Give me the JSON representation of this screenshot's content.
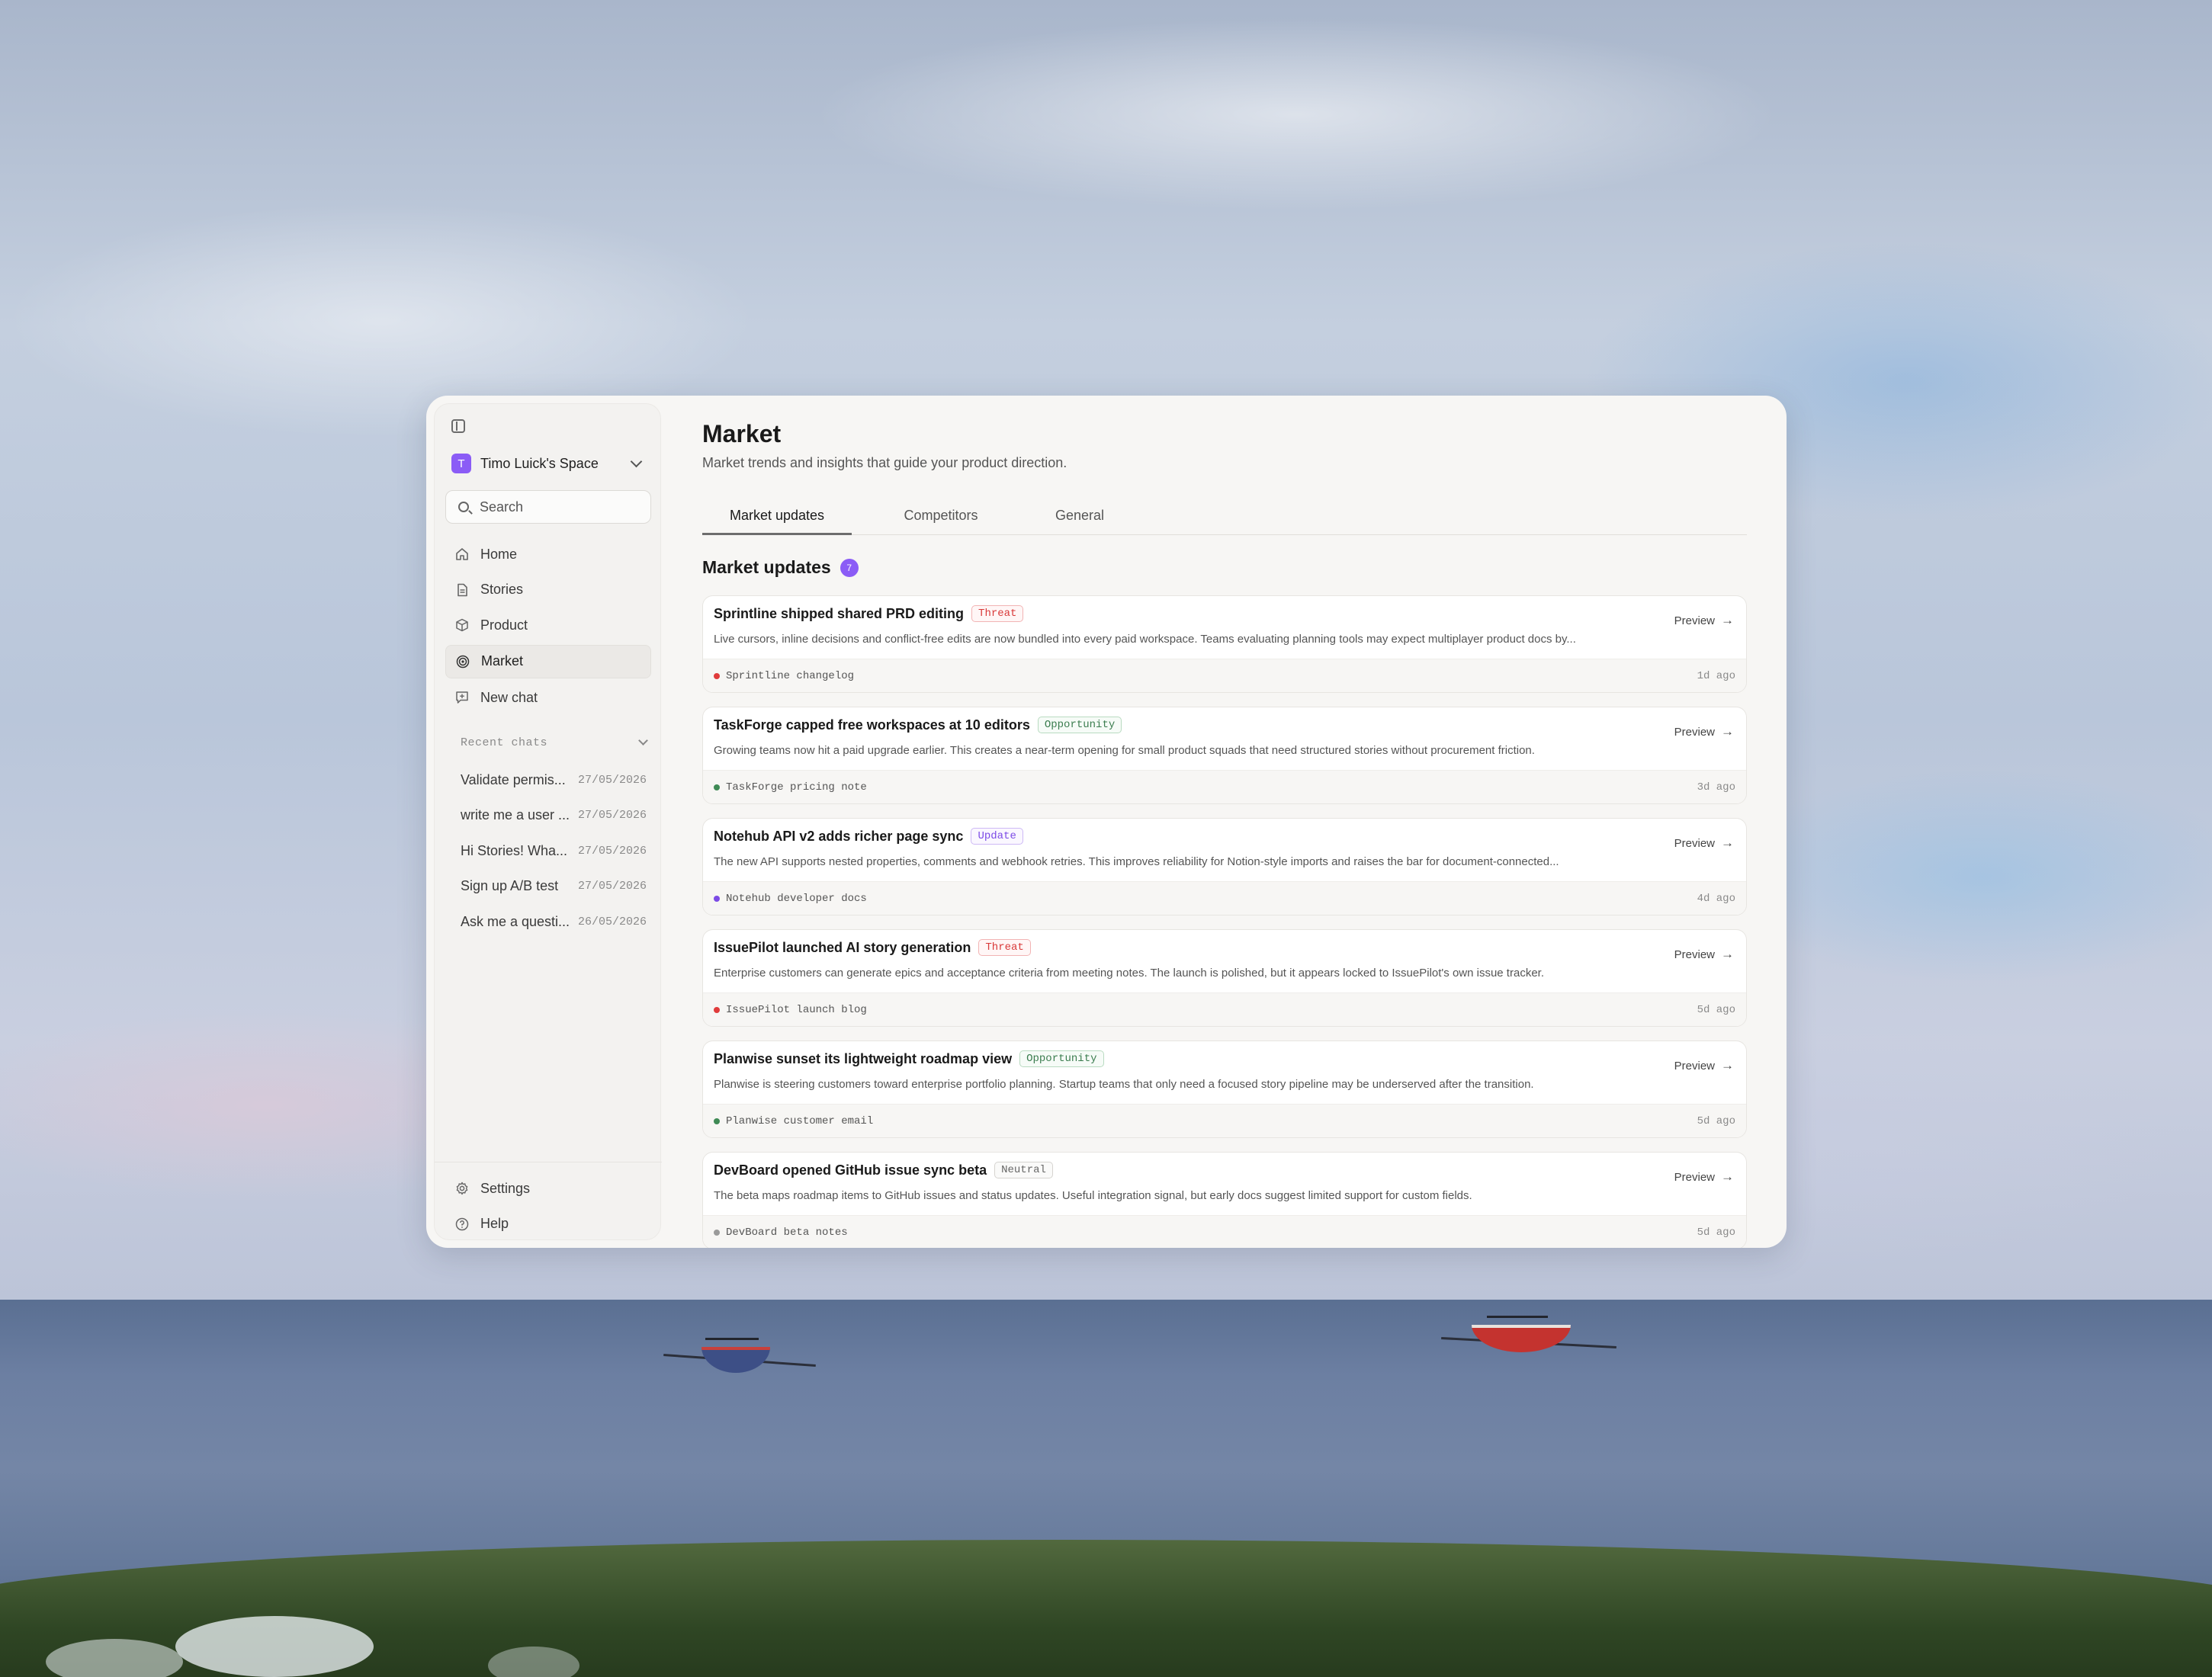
{
  "colors": {
    "accent": "#8b5cf6",
    "threat": "#e03b3b",
    "opportunity": "#3f8a55",
    "update": "#7c4be6",
    "neutral": "#9a9a9a"
  },
  "sidebar": {
    "toggle_icon": "sidebar-toggle-icon",
    "workspace": {
      "initial": "T",
      "name": "Timo Luick's Space"
    },
    "search": {
      "placeholder": "Search"
    },
    "nav": [
      {
        "label": "Home",
        "icon": "home-icon"
      },
      {
        "label": "Stories",
        "icon": "document-icon"
      },
      {
        "label": "Product",
        "icon": "cube-icon"
      },
      {
        "label": "Market",
        "icon": "target-icon",
        "active": true
      },
      {
        "label": "New chat",
        "icon": "chat-plus-icon"
      }
    ],
    "recent_label": "Recent chats",
    "recent": [
      {
        "title": "Validate permis...",
        "date": "27/05/2026"
      },
      {
        "title": "write me a user ...",
        "date": "27/05/2026"
      },
      {
        "title": "Hi Stories! Wha...",
        "date": "27/05/2026"
      },
      {
        "title": "Sign up A/B test",
        "date": "27/05/2026"
      },
      {
        "title": "Ask me a questi...",
        "date": "26/05/2026"
      }
    ],
    "bottom": [
      {
        "label": "Settings",
        "icon": "gear-icon"
      },
      {
        "label": "Help",
        "icon": "help-icon"
      }
    ]
  },
  "main": {
    "title": "Market",
    "subtitle": "Market trends and insights that guide your product direction.",
    "tabs": [
      {
        "label": "Market updates",
        "active": true
      },
      {
        "label": "Competitors"
      },
      {
        "label": "General"
      }
    ],
    "section_title": "Market updates",
    "section_count": "7",
    "preview_label": "Preview",
    "cards": [
      {
        "title": "Sprintline shipped shared PRD editing",
        "tag": "Threat",
        "tag_type": "threat",
        "description": "Live cursors, inline decisions and conflict-free edits are now bundled into every paid workspace. Teams evaluating planning tools may expect multiplayer product docs by...",
        "source": "Sprintline changelog",
        "ago": "1d ago"
      },
      {
        "title": "TaskForge capped free workspaces at 10 editors",
        "tag": "Opportunity",
        "tag_type": "opportunity",
        "description": "Growing teams now hit a paid upgrade earlier. This creates a near-term opening for small product squads that need structured stories without procurement friction.",
        "source": "TaskForge pricing note",
        "ago": "3d ago"
      },
      {
        "title": "Notehub API v2 adds richer page sync",
        "tag": "Update",
        "tag_type": "update",
        "description": "The new API supports nested properties, comments and webhook retries. This improves reliability for Notion-style imports and raises the bar for document-connected...",
        "source": "Notehub developer docs",
        "ago": "4d ago"
      },
      {
        "title": "IssuePilot launched AI story generation",
        "tag": "Threat",
        "tag_type": "threat",
        "description": "Enterprise customers can generate epics and acceptance criteria from meeting notes. The launch is polished, but it appears locked to IssuePilot's own issue tracker.",
        "source": "IssuePilot launch blog",
        "ago": "5d ago"
      },
      {
        "title": "Planwise sunset its lightweight roadmap view",
        "tag": "Opportunity",
        "tag_type": "opportunity",
        "description": "Planwise is steering customers toward enterprise portfolio planning. Startup teams that only need a focused story pipeline may be underserved after the transition.",
        "source": "Planwise customer email",
        "ago": "5d ago"
      },
      {
        "title": "DevBoard opened GitHub issue sync beta",
        "tag": "Neutral",
        "tag_type": "neutral",
        "description": "The beta maps roadmap items to GitHub issues and status updates. Useful integration signal, but early docs suggest limited support for custom fields.",
        "source": "DevBoard beta notes",
        "ago": "5d ago"
      }
    ]
  }
}
